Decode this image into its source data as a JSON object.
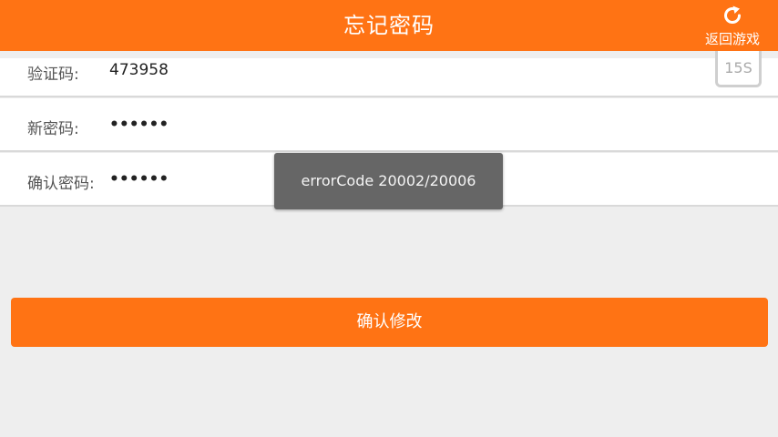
{
  "header": {
    "title": "忘记密码",
    "back_label": "返回游戏"
  },
  "form": {
    "code_label": "验证码:",
    "code_value": "473958",
    "countdown_label": "15S",
    "new_password_label": "新密码:",
    "new_password_value": "••••••",
    "confirm_password_label": "确认密码:",
    "confirm_password_value": "••••••"
  },
  "toast": {
    "message": "errorCode 20002/20006"
  },
  "actions": {
    "confirm_label": "确认修改"
  },
  "colors": {
    "accent": "#ff7314",
    "background": "#eeeeee",
    "toast_bg": "#666666"
  },
  "icons": {
    "back": "refresh-icon"
  }
}
